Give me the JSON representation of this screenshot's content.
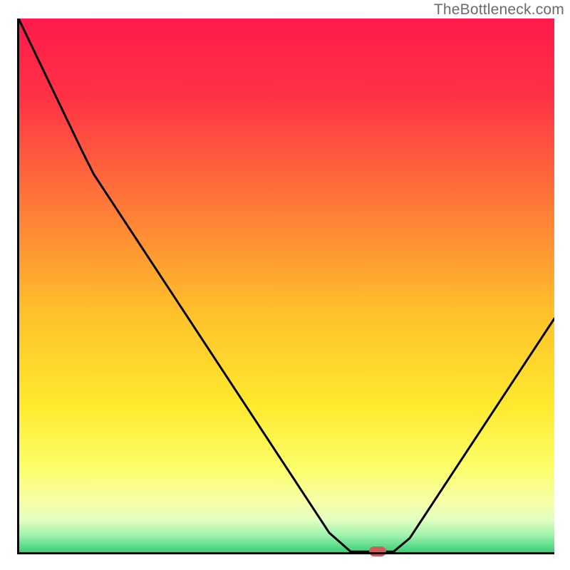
{
  "watermark": "TheBottleneck.com",
  "colors": {
    "gradient_stops": [
      {
        "offset": 0.0,
        "color": "#FF1A4B"
      },
      {
        "offset": 0.15,
        "color": "#FF3345"
      },
      {
        "offset": 0.35,
        "color": "#FF7A38"
      },
      {
        "offset": 0.55,
        "color": "#FFC12A"
      },
      {
        "offset": 0.72,
        "color": "#FFE92E"
      },
      {
        "offset": 0.84,
        "color": "#FCFF6B"
      },
      {
        "offset": 0.9,
        "color": "#F7FEA6"
      },
      {
        "offset": 0.935,
        "color": "#E3FFC0"
      },
      {
        "offset": 0.965,
        "color": "#9DF2AE"
      },
      {
        "offset": 1.0,
        "color": "#2ECB71"
      }
    ],
    "curve": "#000000",
    "axis": "#000000",
    "marker": "#CD5C5C"
  },
  "chart_data": {
    "type": "line",
    "title": "",
    "xlabel": "",
    "ylabel": "",
    "xlim": [
      0,
      100
    ],
    "ylim": [
      0,
      100
    ],
    "curve_points": [
      {
        "x": 0,
        "y": 100
      },
      {
        "x": 12,
        "y": 75
      },
      {
        "x": 14,
        "y": 71
      },
      {
        "x": 58,
        "y": 4
      },
      {
        "x": 62,
        "y": 0.5
      },
      {
        "x": 70,
        "y": 0.5
      },
      {
        "x": 73,
        "y": 3
      },
      {
        "x": 100,
        "y": 44
      }
    ],
    "marker": {
      "x": 67,
      "y": 0.5
    }
  }
}
